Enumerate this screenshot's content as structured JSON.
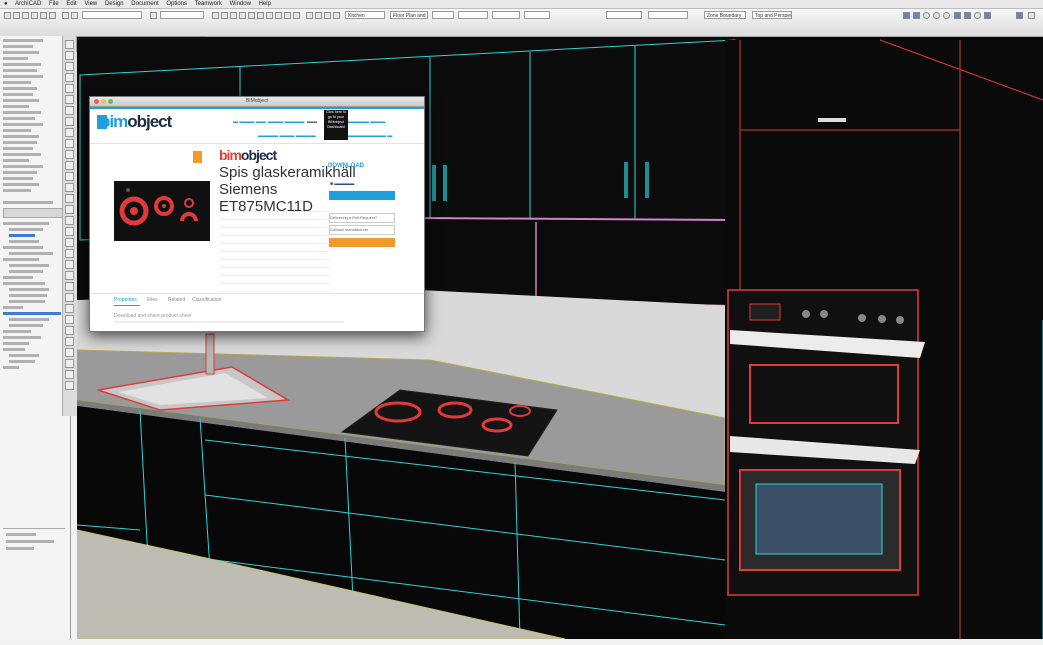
{
  "window": {
    "title": "BIMobject"
  },
  "menu": {
    "items": [
      "ArchiCAD",
      "File",
      "Edit",
      "View",
      "Design",
      "Document",
      "Options",
      "Teamwork",
      "Window",
      "Help"
    ]
  },
  "infobar": {
    "story_field": "Kitchen",
    "view_field": "Floor Plan and Section",
    "layer_field": "Zone Boundary",
    "story_btn": "Top and Perspective"
  },
  "bimwindow": {
    "brand_text": "bimobject",
    "product_brand": "bimobject",
    "product_title": "Spis glaskeramikhäll Siemens ET875MC11D",
    "download_label": "DOWNLOAD",
    "tooltip": "Click here to go to your BIMobject Dashboard",
    "actions": [
      "Delivering a Pull Request?",
      "Contact manufacturer"
    ],
    "tabs": [
      "Properties",
      "Files",
      "Related",
      "Classification"
    ],
    "hint": "Download and share product sheet"
  },
  "colors": {
    "brand_blue": "#1ea0dc",
    "brand_orange": "#f39a2c",
    "wire_cyan": "#2ad4d8",
    "wire_red": "#e03a3a"
  }
}
